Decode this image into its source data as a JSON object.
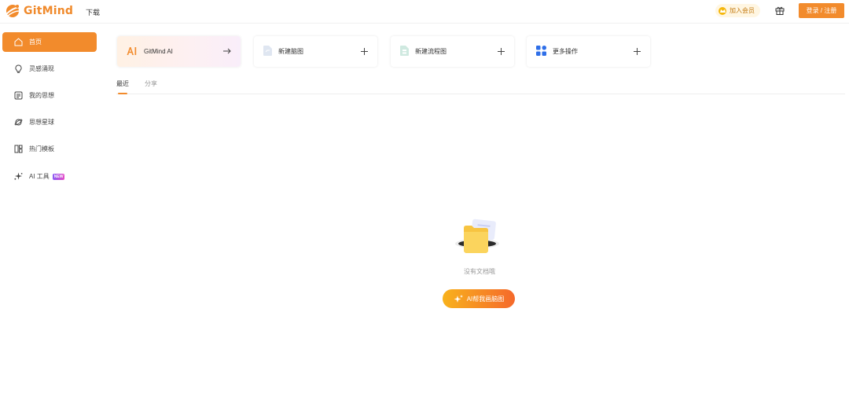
{
  "header": {
    "logo_text": "GitMind",
    "nav_download": "下载",
    "vip_label": "加入会员",
    "login_label": "登录 / 注册",
    "icons": {
      "logo": "gitmind-logo-icon",
      "vip": "crown-icon",
      "gift": "gift-icon"
    }
  },
  "sidebar": {
    "items": [
      {
        "label": "首页",
        "icon": "home-icon",
        "active": true
      },
      {
        "label": "灵感涌现",
        "icon": "lightbulb-icon",
        "active": false
      },
      {
        "label": "我的思想",
        "icon": "document-icon",
        "active": false
      },
      {
        "label": "思想星球",
        "icon": "planet-icon",
        "active": false
      },
      {
        "label": "热门模板",
        "icon": "template-icon",
        "active": false
      },
      {
        "label": "AI 工具",
        "icon": "sparkle-icon",
        "active": false,
        "badge": "NEW"
      }
    ]
  },
  "cards": [
    {
      "label": "GitMind AI",
      "icon": "ai-logo-icon",
      "action_icon": "arrow-right-icon"
    },
    {
      "label": "新建脑图",
      "icon": "mindmap-file-icon",
      "action_icon": "plus-icon"
    },
    {
      "label": "新建流程图",
      "icon": "flowchart-file-icon",
      "action_icon": "plus-icon"
    },
    {
      "label": "更多操作",
      "icon": "grid-icon",
      "action_icon": "plus-icon"
    }
  ],
  "tabs": [
    {
      "label": "最近",
      "active": true
    },
    {
      "label": "分享",
      "active": false
    }
  ],
  "empty_state": {
    "message": "没有文档哦",
    "button_label": "AI帮我画脑图",
    "illustration": "empty-folder-icon"
  },
  "colors": {
    "accent": "#f28b2c",
    "brand": "#f08a2c",
    "ai_gradient_start": "#f8b21c",
    "ai_gradient_end": "#f5692b"
  }
}
